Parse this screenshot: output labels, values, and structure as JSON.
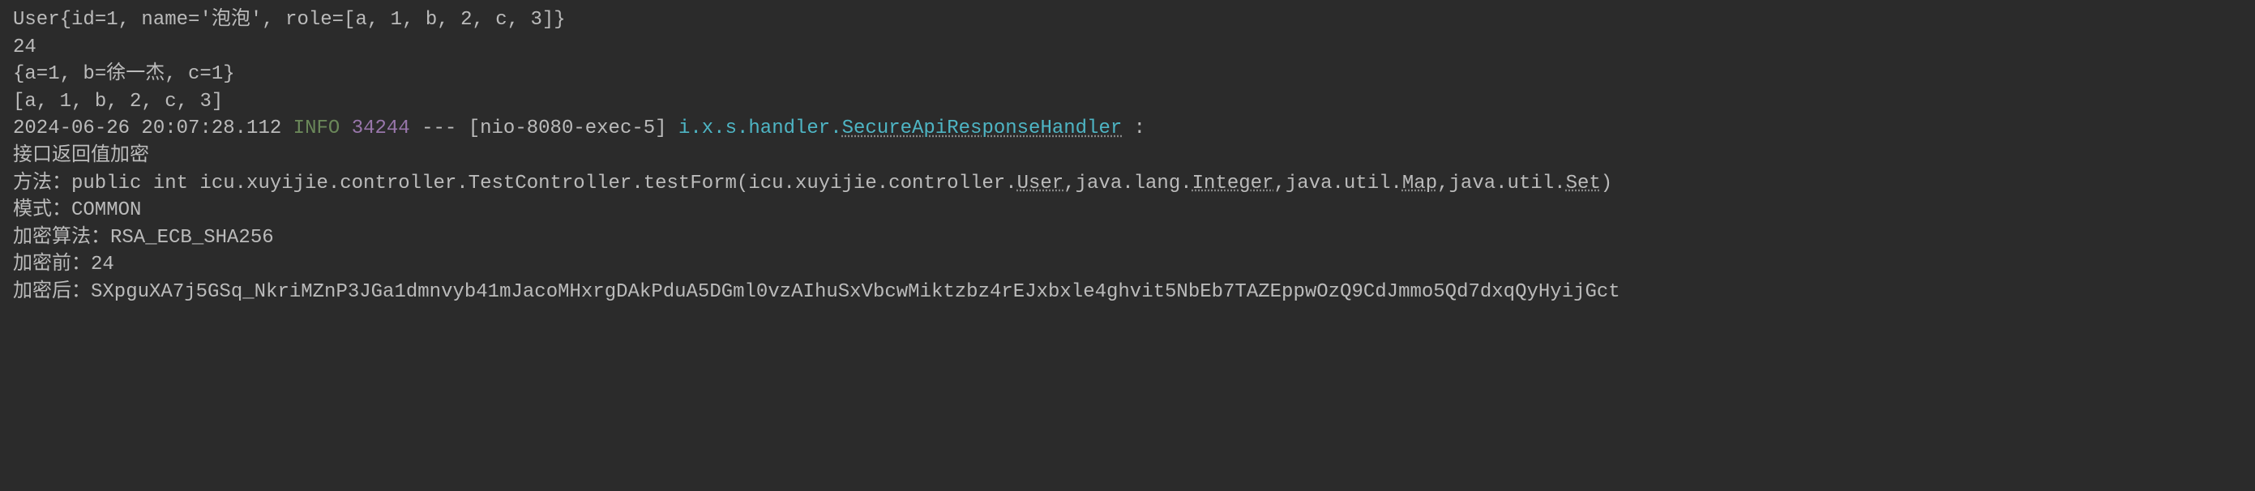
{
  "lines": {
    "line1": "User{id=1, name='泡泡', role=[a, 1, b, 2, c, 3]}",
    "line2": "24",
    "line3": "{a=1, b=徐一杰, c=1}",
    "line4": "[a, 1, b, 2, c, 3]",
    "line5": {
      "timestamp": "2024-06-26 20:07:28.112",
      "level": "INFO",
      "pid": "34244",
      "sep": " --- ",
      "thread": "[nio-8080-exec-5]",
      "logger_prefix": "i.x.s.handler.",
      "logger_class": "SecureApiResponseHandler",
      "colon": "   :"
    },
    "line6": "接口返回值加密",
    "line7": {
      "label": "方法：",
      "sig_pre": "public int icu.xuyijie.controller.TestController.testForm(icu.xuyijie.controller.",
      "sig_user": "User",
      "sig_mid1": ",java.lang.",
      "sig_integer": "Integer",
      "sig_mid2": ",java.util.",
      "sig_map": "Map",
      "sig_mid3": ",java.util.",
      "sig_set": "Set",
      "sig_end": ")"
    },
    "line8": {
      "label": "模式：",
      "value": "COMMON"
    },
    "line9": {
      "label": "加密算法：",
      "value": "RSA_ECB_SHA256"
    },
    "line10": {
      "label": "加密前：",
      "value": "24"
    },
    "line11": {
      "label": "加密后：",
      "value": "SXpguXA7j5GSq_NkriMZnP3JGa1dmnvyb41mJacoMHxrgDAkPduA5DGml0vzAIhuSxVbcwMiktzbz4rEJxbxle4ghvit5NbEb7TAZEppwOzQ9CdJmmo5Qd7dxqQyHyijGct"
    }
  }
}
